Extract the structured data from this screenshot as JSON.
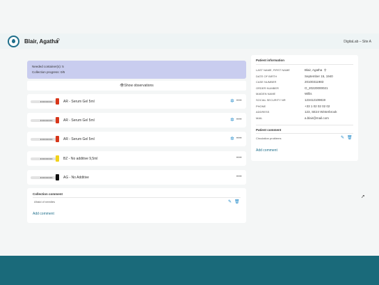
{
  "header": {
    "patient_name": "Blair, Agatha",
    "site": "DigitaLab – Site A"
  },
  "collection": {
    "needed_containers": "Needed container(s): 5",
    "progress": "Collection progress: 0/5",
    "show_observations": "Show observations"
  },
  "tubes": [
    {
      "label": "AR - Serum Gel 5ml",
      "cap_color": "#d7361a",
      "has_gear": true
    },
    {
      "label": "AR - Serum Gel 5ml",
      "cap_color": "#d7361a",
      "has_gear": true
    },
    {
      "label": "AR - Serum Gel 5ml",
      "cap_color": "#d7361a",
      "has_gear": true
    },
    {
      "label": "BZ - No additive 9,5ml",
      "cap_color": "#f2d21b",
      "has_gear": false
    },
    {
      "label": "AG - No Additive",
      "cap_color": "#111111",
      "has_gear": false
    }
  ],
  "collection_comment": {
    "title": "Collection comment",
    "text": "Afraid of needles",
    "add_label": "Add comment"
  },
  "patient_info": {
    "title": "Patient information",
    "fields": [
      {
        "key": "LAST NAME, FIRST NAME",
        "value": "Blair, Agatha"
      },
      {
        "key": "DATE OF BIRTH",
        "value": "September 15, 1940"
      },
      {
        "key": "CASE NUMBER",
        "value": "20100311983"
      },
      {
        "key": "ORDER NUMBER",
        "value": "O_20220000021"
      },
      {
        "key": "MAIDEN NAME",
        "value": "Willis"
      },
      {
        "key": "SOCIAL SECURITY NR",
        "value": "123412109819"
      },
      {
        "key": "PHONE",
        "value": "+33 1 02 02 02 02"
      },
      {
        "key": "ADDRESS",
        "value": "123, SE24 Winterbrook"
      },
      {
        "key": "MAIL",
        "value": "a.blair@mail.com"
      }
    ]
  },
  "patient_comment": {
    "title": "Patient comment",
    "text": "Circulation problems",
    "add_label": "Add comment"
  },
  "colors": {
    "accent": "#1f6f8b",
    "info_box": "#c9cdef",
    "footer": "#1a6a7a"
  }
}
